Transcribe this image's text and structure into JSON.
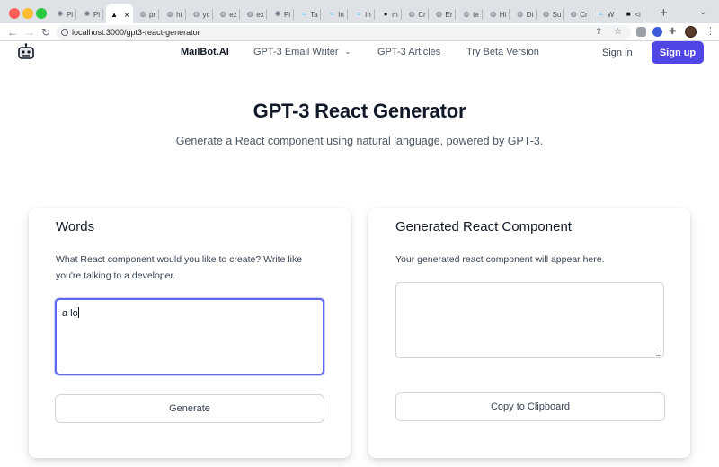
{
  "browser": {
    "tabs": [
      {
        "favicon": "openai-icon",
        "label": "Pl"
      },
      {
        "favicon": "openai-icon",
        "label": "Pl"
      },
      {
        "favicon": "vercel-icon",
        "label": "",
        "active": true
      },
      {
        "favicon": "globe-icon",
        "label": "pr"
      },
      {
        "favicon": "globe-icon",
        "label": "ht"
      },
      {
        "favicon": "globe-icon",
        "label": "yc"
      },
      {
        "favicon": "globe-icon",
        "label": "ez"
      },
      {
        "favicon": "globe-icon",
        "label": "ex"
      },
      {
        "favicon": "openai-icon",
        "label": "Pl"
      },
      {
        "favicon": "tailwind-icon",
        "label": "Ta"
      },
      {
        "favicon": "tailwind-icon",
        "label": "In"
      },
      {
        "favicon": "tailwind-icon",
        "label": "In"
      },
      {
        "favicon": "github-icon",
        "label": "m"
      },
      {
        "favicon": "globe-icon",
        "label": "Cr"
      },
      {
        "favicon": "globe-icon",
        "label": "Er"
      },
      {
        "favicon": "globe-icon",
        "label": "te"
      },
      {
        "favicon": "globe-icon",
        "label": "Hi"
      },
      {
        "favicon": "globe-icon",
        "label": "Di"
      },
      {
        "favicon": "globe-icon",
        "label": "Su"
      },
      {
        "favicon": "globe-icon",
        "label": "Cr"
      },
      {
        "favicon": "tailwind-icon",
        "label": "W"
      },
      {
        "favicon": "notion-icon",
        "label": "<i"
      }
    ],
    "active_tab_close": "×",
    "new_tab": "+",
    "url": "localhost:3000/gpt3-react-generator"
  },
  "site_nav": {
    "brand": "MailBot.AI",
    "links": [
      "GPT-3 Email Writer",
      "GPT-3 Articles",
      "Try Beta Version"
    ],
    "dropdown_chevron": "⌄",
    "sign_in": "Sign in",
    "sign_up": "Sign up"
  },
  "hero": {
    "title": "GPT-3 React Generator",
    "subtitle": "Generate a React component using natural language, powered by GPT-3."
  },
  "words_card": {
    "title": "Words",
    "description": "What React component would you like to create? Write like you're talking to a developer.",
    "input_value": "a lo",
    "button": "Generate"
  },
  "output_card": {
    "title": "Generated React Component",
    "description": "Your generated react component will appear here.",
    "output_value": "",
    "button": "Copy to Clipboard"
  },
  "colors": {
    "accent": "#4f46e5",
    "focus_ring": "#6366f1"
  }
}
